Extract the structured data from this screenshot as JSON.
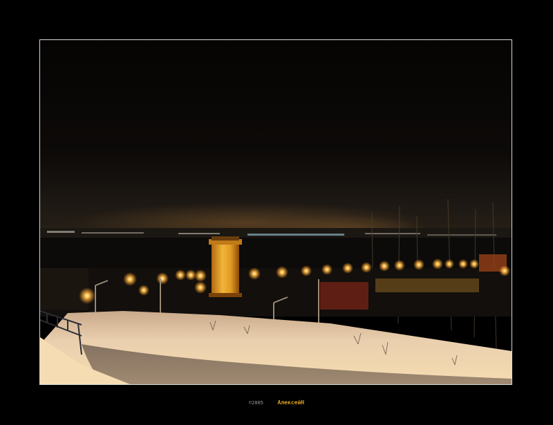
{
  "caption": {
    "copyright": "©2005",
    "author": "АлексейН"
  },
  "colors": {
    "background": "#000000",
    "frame_border": "#d8d8d8",
    "lamp_glow": "#ffb030",
    "tower": "#e8a020",
    "snow": "#f3dcb4",
    "author_text": "#d9a21c"
  }
}
